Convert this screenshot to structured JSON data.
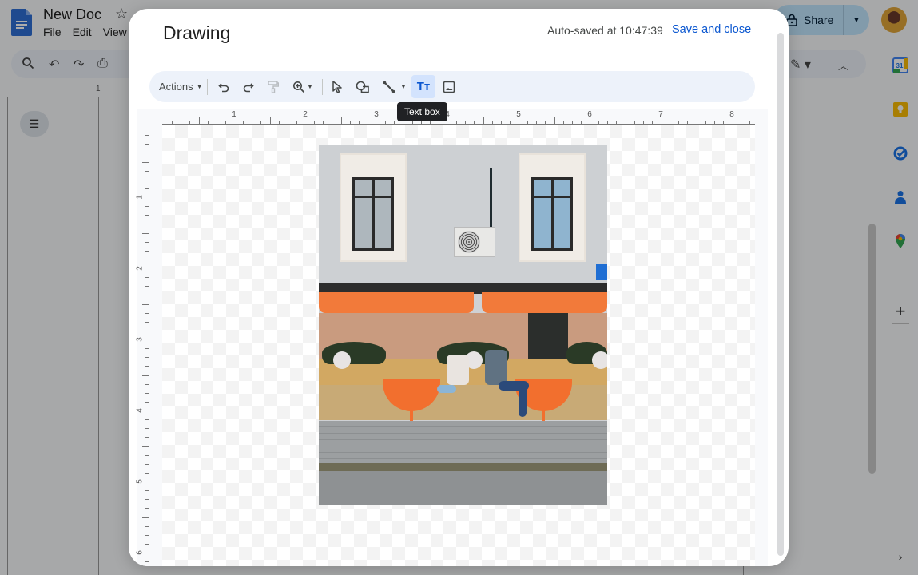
{
  "docs": {
    "title": "New Doc",
    "menu": [
      "File",
      "Edit",
      "View"
    ],
    "share_label": "Share",
    "ruler_label": "1",
    "icons": {
      "logo": "google-docs-icon",
      "star": "star-icon",
      "search": "search-icon",
      "undo": "undo-icon",
      "redo": "redo-icon",
      "print": "print-icon",
      "lock": "lock-icon",
      "outline": "outline-icon",
      "collapse": "chevron-up-icon",
      "expand": "chevron-right-icon"
    },
    "side_panel": {
      "calendar_label": "31",
      "items": [
        "calendar-icon",
        "keep-icon",
        "tasks-icon",
        "contacts-icon",
        "maps-icon"
      ],
      "add_label": "+"
    }
  },
  "drawing": {
    "title": "Drawing",
    "autosave": "Auto-saved at 10:47:39",
    "save_close": "Save and close",
    "toolbar": {
      "actions_label": "Actions",
      "text_box_label": "Tт",
      "tooltip": "Text box"
    },
    "ruler_h": [
      "1",
      "2",
      "3",
      "4",
      "5",
      "6",
      "7",
      "8"
    ],
    "ruler_v": [
      "1",
      "2",
      "3",
      "4",
      "5",
      "6"
    ],
    "image": {
      "description": "Street cafe with orange awnings, two people seated on benches at orange half-round tables"
    }
  },
  "colors": {
    "accent": "#0b57d0",
    "share_bg": "#c2e7ff",
    "toolbar_bg": "#edf2fa",
    "selected_tool_bg": "#d3e3fd",
    "awning": "#f27a3a"
  }
}
